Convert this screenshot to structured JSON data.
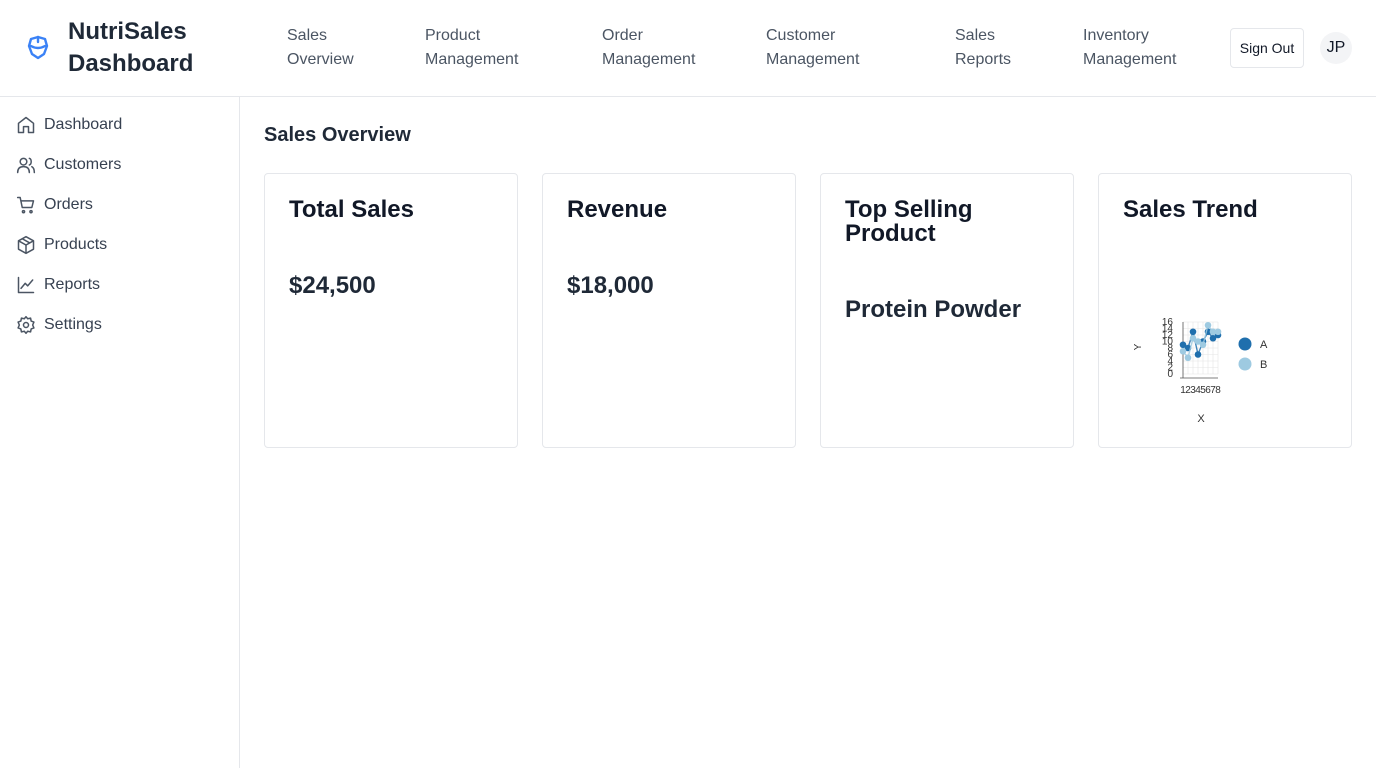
{
  "header": {
    "title": "NutriSales Dashboard",
    "nav": [
      "Sales Overview",
      "Product Management",
      "Order Management",
      "Customer Management",
      "Sales Reports",
      "Inventory Management"
    ],
    "sign_out": "Sign Out",
    "avatar": "JP",
    "accent": "#3b82f6"
  },
  "sidebar": {
    "items": [
      {
        "label": "Dashboard",
        "icon": "home-icon"
      },
      {
        "label": "Customers",
        "icon": "users-icon"
      },
      {
        "label": "Orders",
        "icon": "cart-icon"
      },
      {
        "label": "Products",
        "icon": "package-icon"
      },
      {
        "label": "Reports",
        "icon": "chart-line-icon"
      },
      {
        "label": "Settings",
        "icon": "gear-icon"
      }
    ]
  },
  "main": {
    "title": "Sales Overview",
    "cards": [
      {
        "title": "Total Sales",
        "value": "$24,500"
      },
      {
        "title": "Revenue",
        "value": "$18,000"
      },
      {
        "title": "Top Selling Product",
        "value": "Protein Powder"
      },
      {
        "title": "Sales Trend"
      }
    ]
  },
  "chart_data": {
    "type": "scatter",
    "title": "Sales Trend",
    "xlabel": "X",
    "ylabel": "Y",
    "ylim": [
      0,
      16
    ],
    "y_ticks": [
      0,
      2,
      4,
      6,
      8,
      10,
      12,
      14,
      16
    ],
    "x": [
      1,
      2,
      3,
      4,
      5,
      6,
      7,
      8
    ],
    "series": [
      {
        "name": "A",
        "color": "#1f6fad",
        "values": [
          9,
          8,
          13,
          6,
          10,
          13,
          11,
          12
        ]
      },
      {
        "name": "B",
        "color": "#9ecae1",
        "values": [
          7,
          5,
          11,
          10,
          9,
          15,
          13,
          13
        ]
      }
    ],
    "legend": "right",
    "grid": true
  }
}
